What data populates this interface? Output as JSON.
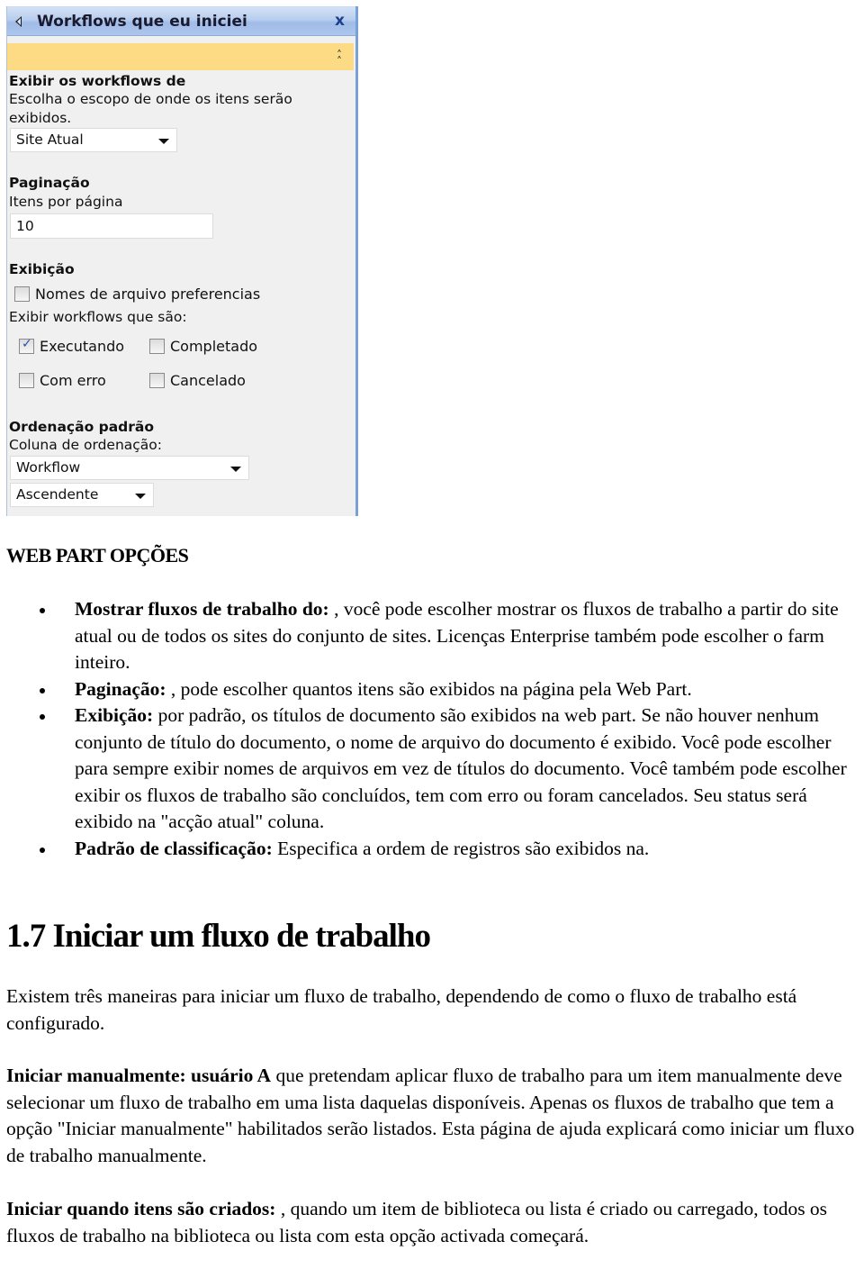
{
  "webpart_panel": {
    "title": "Workflows que eu iniciei",
    "close_icon": "close-x-icon",
    "collapse_icon": "double-chevron-up-icon",
    "colors": {
      "header_blue": "#aec6ec",
      "band_yellow": "#fdda84",
      "body_grey": "#f0f0f0",
      "close_blue": "#1e3f8a"
    },
    "show_from": {
      "heading": "Exibir os workflows de",
      "description": "Escolha o escopo de onde os itens serão exibidos.",
      "selected": "Site Atual"
    },
    "paging": {
      "heading": "Paginação",
      "label": "Itens por página",
      "value": "10"
    },
    "display": {
      "heading": "Exibição",
      "prefer_filenames_label": "Nomes de arquivo preferencias",
      "prefer_filenames_checked": false,
      "show_label": "Exibir workflows que são:",
      "statuses": [
        {
          "label": "Executando",
          "checked": true
        },
        {
          "label": "Completado",
          "checked": false
        },
        {
          "label": "Com erro",
          "checked": false
        },
        {
          "label": "Cancelado",
          "checked": false
        }
      ]
    },
    "sorting": {
      "heading": "Ordenação padrão",
      "label": "Coluna de ordenação:",
      "column_selected": "Workflow",
      "direction_selected": "Ascendente"
    }
  },
  "document": {
    "options_heading": "WEB PART OPÇÕES",
    "bullets": [
      {
        "term": "Mostrar fluxos de trabalho do:",
        "text": " , você pode escolher mostrar os fluxos de trabalho a partir do site atual ou de todos os sites do conjunto de sites. Licenças Enterprise também pode escolher o farm inteiro."
      },
      {
        "term": "Paginação:",
        "text": " , pode escolher quantos itens são exibidos na página pela Web Part."
      },
      {
        "term": "Exibição:",
        "text": " por padrão, os títulos de documento são exibidos na web part. Se não houver nenhum conjunto de título do documento, o nome de arquivo do documento é exibido. Você pode escolher para sempre exibir nomes de arquivos em vez de títulos do documento. Você também pode escolher exibir os fluxos de trabalho são concluídos, tem com erro ou foram cancelados. Seu status será exibido na \"acção atual\" coluna."
      },
      {
        "term": "Padrão de classificação:",
        "text": " Especifica a ordem de registros são exibidos na."
      }
    ],
    "section_heading": "1.7 Iniciar um fluxo de trabalho",
    "intro": "Existem três maneiras para iniciar um fluxo de trabalho, dependendo de como o fluxo de trabalho está configurado.",
    "manual": {
      "term": "Iniciar manualmente: usuário A",
      "text": " que pretendam aplicar fluxo de trabalho para um item manualmente deve selecionar um fluxo de trabalho em uma lista daquelas disponíveis. Apenas os fluxos de trabalho que tem a opção \"Iniciar manualmente\" habilitados serão listados. Esta página de ajuda explicará como iniciar um fluxo de trabalho manualmente."
    },
    "on_create": {
      "term": "Iniciar quando itens são criados:",
      "text": " , quando um item de biblioteca ou lista é criado ou carregado, todos os fluxos de trabalho na biblioteca ou lista com esta opção activada começará."
    }
  }
}
